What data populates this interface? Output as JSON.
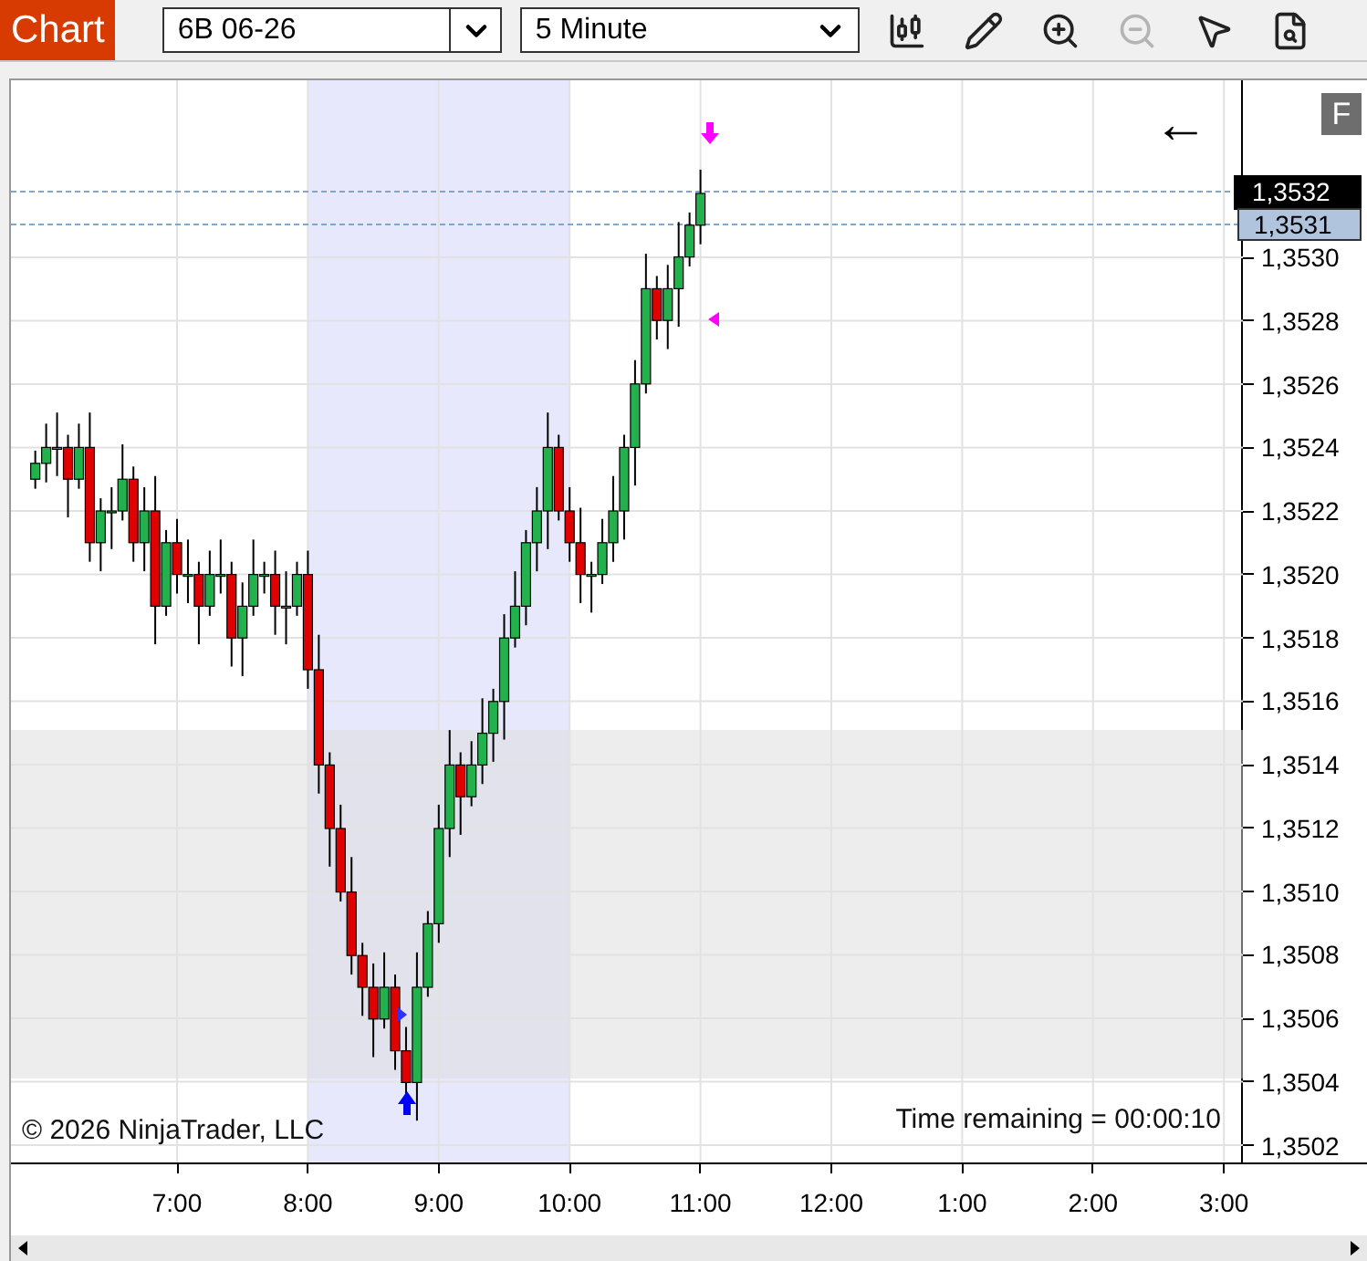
{
  "toolbar": {
    "title": "Chart",
    "instrument": "6B 06-26",
    "interval": "5 Minute",
    "tools": [
      {
        "kind": "bars",
        "disabled": false
      },
      {
        "kind": "pencil",
        "disabled": false
      },
      {
        "kind": "zoom-in",
        "disabled": false
      },
      {
        "kind": "zoom-out",
        "disabled": true
      },
      {
        "kind": "pointer",
        "disabled": false
      },
      {
        "kind": "properties",
        "disabled": false
      }
    ]
  },
  "chart": {
    "badge": "F",
    "back_arrow": "←",
    "price_axis": [
      "1,3530",
      "1,3528",
      "1,3526",
      "1,3524",
      "1,3522",
      "1,3520",
      "1,3518",
      "1,3516",
      "1,3514",
      "1,3512",
      "1,3510",
      "1,3508",
      "1,3506",
      "1,3504",
      "1,3502"
    ],
    "last_price": "1,3532",
    "bid_price": "1,3531",
    "time_axis": [
      "7:00",
      "8:00",
      "9:00",
      "10:00",
      "11:00",
      "12:00",
      "1:00",
      "2:00",
      "3:00"
    ],
    "copyright": "© 2026 NinjaTrader, LLC",
    "time_remaining": "Time remaining = 00:00:10"
  }
}
